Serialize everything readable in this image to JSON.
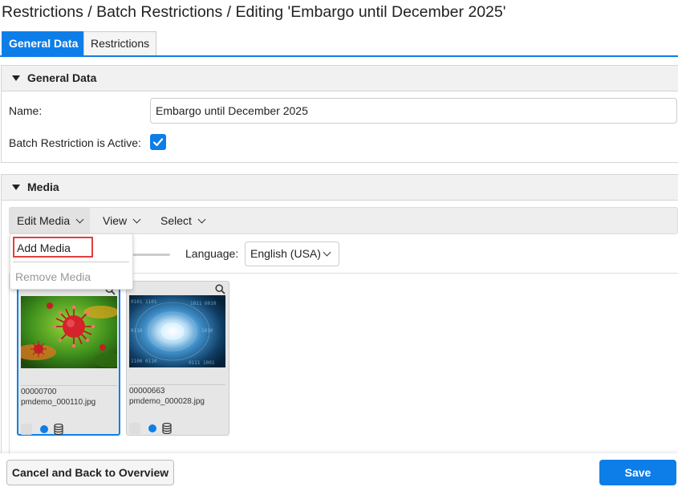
{
  "page": {
    "title": "Restrictions / Batch Restrictions / Editing 'Embargo until December 2025'"
  },
  "tabs": [
    {
      "label": "General Data",
      "active": true
    },
    {
      "label": "Restrictions",
      "active": false
    }
  ],
  "general": {
    "header": "General Data",
    "name_label": "Name:",
    "name_value": "Embargo until December 2025",
    "active_label": "Batch Restriction is Active:",
    "active_checked": true
  },
  "media": {
    "header": "Media",
    "toolbar": {
      "edit_media": "Edit Media",
      "view": "View",
      "select": "Select"
    },
    "dropdown": {
      "add_media": "Add Media",
      "remove_media": "Remove Media"
    },
    "language_label": "Language:",
    "language_value": "English (USA)",
    "items": [
      {
        "id": "00000700",
        "filename": "pmdemo_000110.jpg",
        "selected": true,
        "thumb": "virus"
      },
      {
        "id": "00000663",
        "filename": "pmdemo_000028.jpg",
        "selected": false,
        "thumb": "binary-tunnel"
      }
    ]
  },
  "footer": {
    "cancel_label": "Cancel and Back to Overview",
    "save_label": "Save"
  },
  "colors": {
    "accent": "#0d7ee8",
    "highlight_border": "#e04040"
  }
}
